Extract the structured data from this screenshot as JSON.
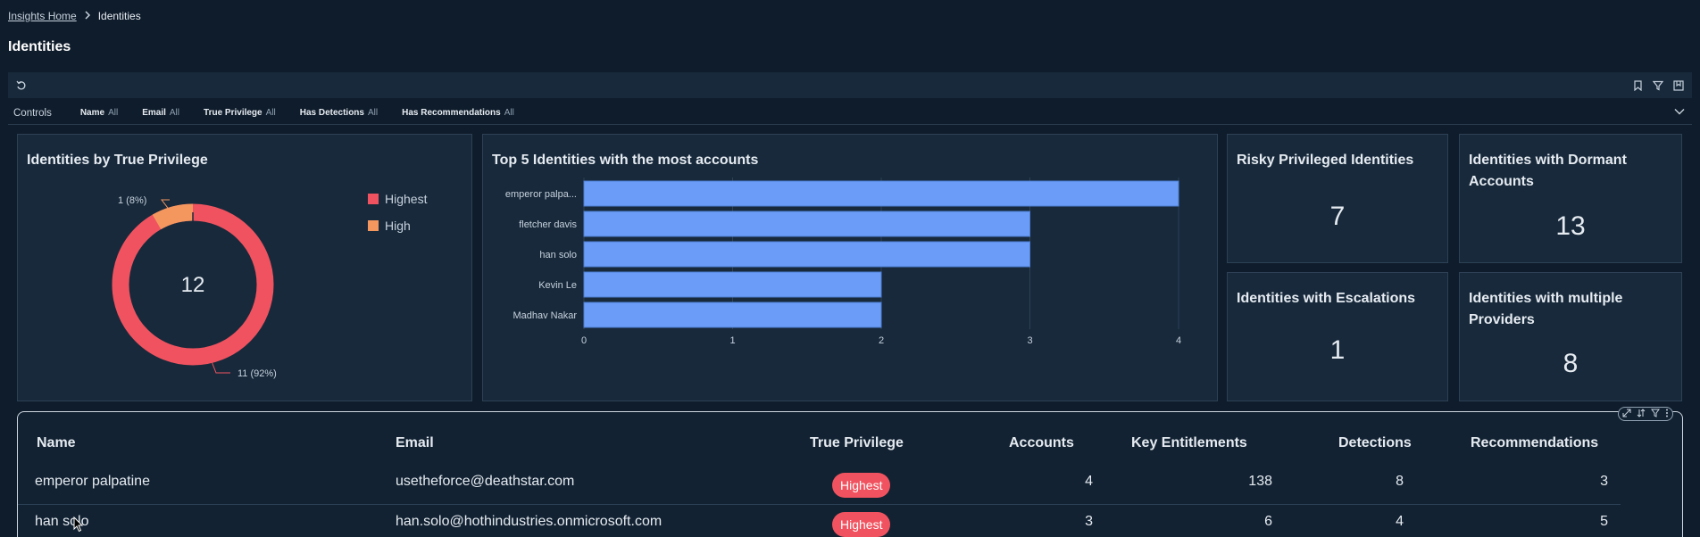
{
  "breadcrumb": {
    "home": "Insights Home",
    "current": "Identities"
  },
  "page": {
    "title": "Identities"
  },
  "toolbar": {
    "icons": [
      "refresh-icon",
      "bookmark-icon",
      "filter-icon",
      "save-icon"
    ]
  },
  "controls": {
    "label": "Controls",
    "filters": [
      {
        "name": "Name",
        "value": "All"
      },
      {
        "name": "Email",
        "value": "All"
      },
      {
        "name": "True Privilege",
        "value": "All"
      },
      {
        "name": "Has Detections",
        "value": "All"
      },
      {
        "name": "Has Recommendations",
        "value": "All"
      }
    ]
  },
  "donut": {
    "title": "Identities by True Privilege",
    "center_value": "12",
    "labels": {
      "high": "1 (8%)",
      "highest": "11 (92%)"
    },
    "legend": [
      {
        "label": "Highest",
        "color": "#f0535f"
      },
      {
        "label": "High",
        "color": "#f4975f"
      }
    ]
  },
  "chart_data": {
    "type": "bar",
    "orientation": "horizontal",
    "title": "Top 5 Identities with the most accounts",
    "categories": [
      "emperor palpa...",
      "fletcher davis",
      "han solo",
      "Kevin Le",
      "Madhav Nakar"
    ],
    "values": [
      4,
      3,
      3,
      2,
      2
    ],
    "xlim": [
      0,
      4
    ],
    "xticks": [
      "0",
      "1",
      "2",
      "3",
      "4"
    ],
    "bar_color": "#6b9cf7",
    "grid": true
  },
  "kpis": [
    {
      "title": "Risky Privileged Identities",
      "value": "7"
    },
    {
      "title": "Identities with Dormant Accounts",
      "value": "13"
    },
    {
      "title": "Identities with Escalations",
      "value": "1"
    },
    {
      "title": "Identities with multiple Providers",
      "value": "8"
    }
  ],
  "table": {
    "columns": [
      "Name",
      "Email",
      "True Privilege",
      "Accounts",
      "Key Entitlements",
      "Detections",
      "Recommendations"
    ],
    "rows": [
      {
        "name": "emperor palpatine",
        "email": "usetheforce@deathstar.com",
        "privilege": "Highest",
        "accounts": "4",
        "entitlements": "138",
        "detections": "8",
        "recommendations": "3"
      },
      {
        "name": "han solo",
        "email": "han.solo@hothindustries.onmicrosoft.com",
        "privilege": "Highest",
        "accounts": "3",
        "entitlements": "6",
        "detections": "4",
        "recommendations": "5"
      }
    ]
  },
  "colors": {
    "highest": "#f0535f",
    "high": "#f4975f",
    "bar": "#6b9cf7",
    "background": "#0f1c2b",
    "card": "#17293b"
  }
}
